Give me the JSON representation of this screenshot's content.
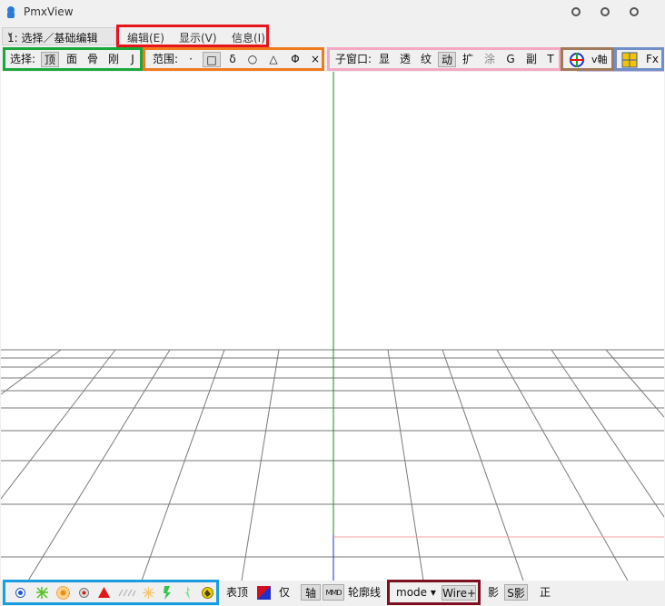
{
  "window": {
    "title": "PmxView"
  },
  "mode_select": {
    "value": "1: 选择／基础编辑"
  },
  "menu": {
    "edit": "编辑(E)",
    "view": "显示(V)",
    "info": "信息(I)"
  },
  "select_group": {
    "label": "选择:",
    "items": [
      "顶",
      "面",
      "骨",
      "刚",
      "J"
    ]
  },
  "range_group": {
    "label": "范围:",
    "items": [
      "·",
      "□",
      "δ",
      "○",
      "△",
      "Φ",
      "×"
    ]
  },
  "subwindow_group": {
    "label": "子窗口:",
    "items": [
      "显",
      "透",
      "纹",
      "动",
      "扩",
      "涂",
      "G",
      "副",
      "T"
    ]
  },
  "axis_group": {
    "v_axis": "v軸"
  },
  "fx_group": {
    "fx": "Fx"
  },
  "bottom": {
    "surface_vertex": "表顶",
    "only": "仅",
    "axis": "轴",
    "mmd": "MMD",
    "outline": "轮廓线",
    "mode_label": "mode ▾",
    "wire": "Wire+",
    "shadow": "影",
    "s_shadow": "S影",
    "ortho": "正"
  },
  "colors": {
    "menu_frame": "#e8141c",
    "select_frame": "#1aa83c",
    "range_frame": "#f07a20",
    "subwindow_frame": "#f3a8c4",
    "axis_frame": "#a07a5a",
    "fx_frame": "#6f8fc6",
    "transform_frame": "#c9c0e6",
    "display_frame": "#1a9ee0",
    "mode_frame": "#7a1020"
  }
}
